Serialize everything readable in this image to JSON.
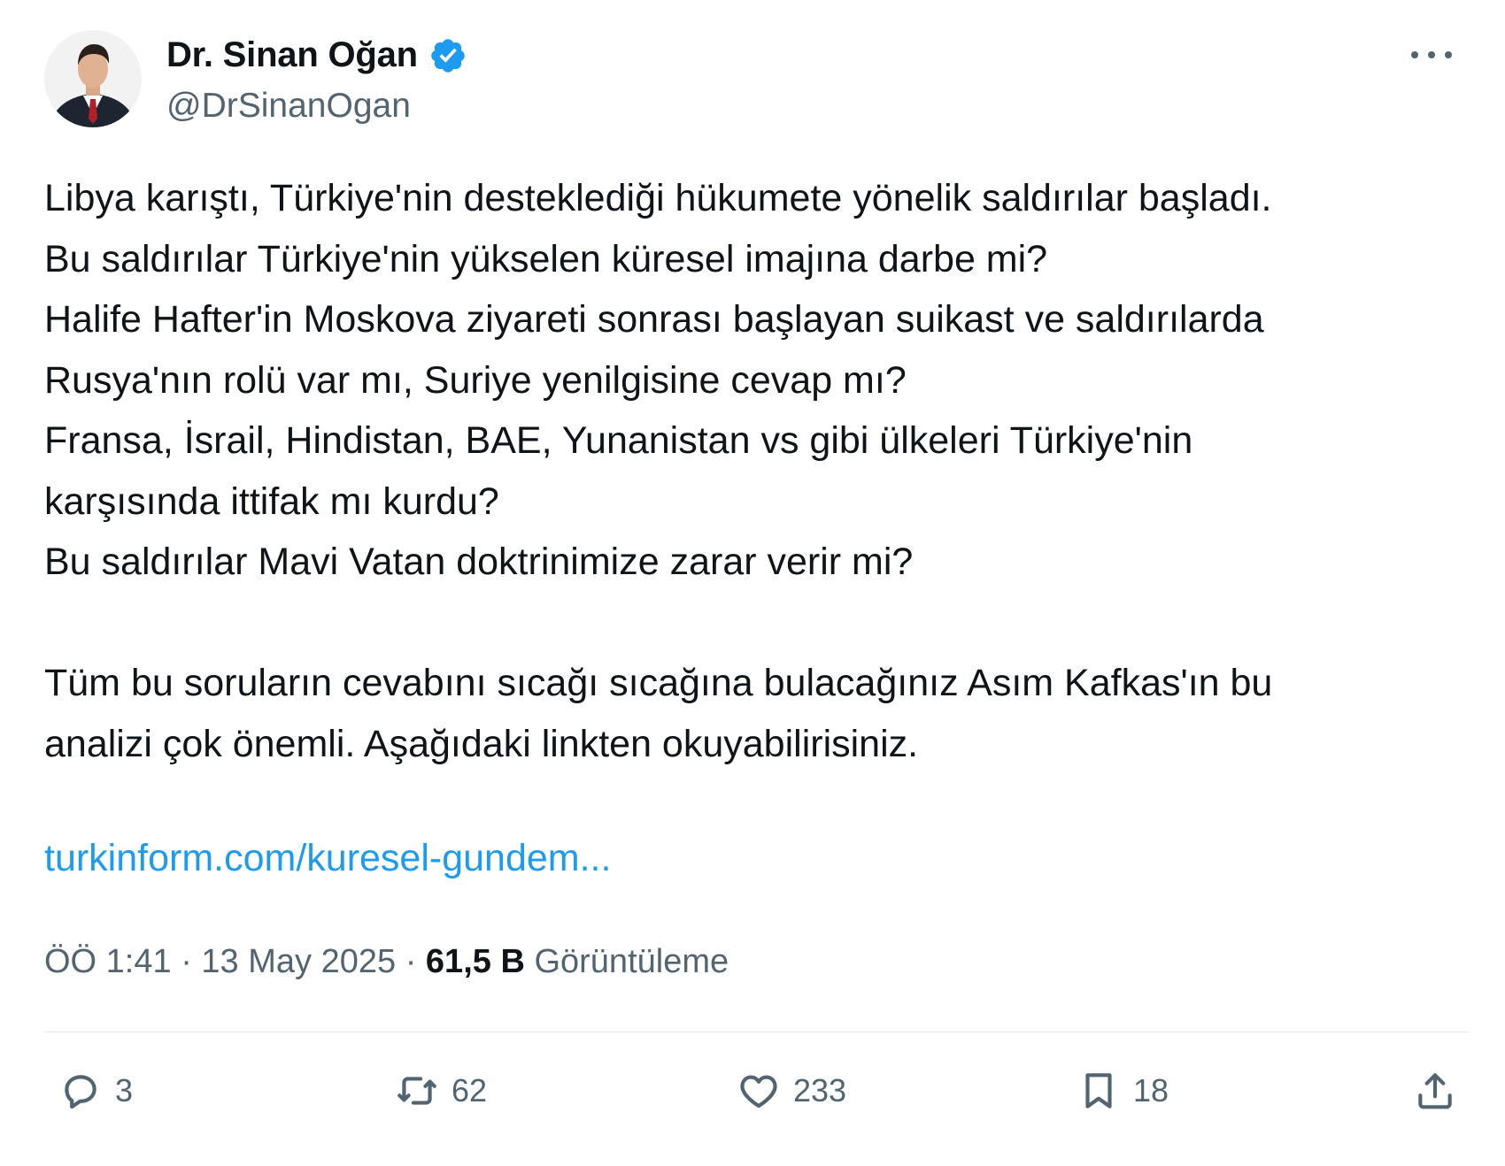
{
  "author": {
    "display_name": "Dr. Sinan Oğan",
    "handle": "@DrSinanOgan",
    "verified": true,
    "verified_color": "#1d9bf0"
  },
  "tweet": {
    "lines": [
      "Libya karıştı, Türkiye'nin desteklediği hükumete yönelik saldırılar başladı.",
      "Bu saldırılar Türkiye'nin yükselen küresel imajına darbe mi?",
      "Halife Hafter'in Moskova ziyareti sonrası başlayan suikast ve saldırılarda",
      "Rusya'nın rolü var mı, Suriye yenilgisine cevap mı?",
      "Fransa, İsrail, Hindistan, BAE, Yunanistan vs gibi ülkeleri Türkiye'nin",
      "karşısında ittifak mı kurdu?",
      "Bu saldırılar Mavi Vatan doktrinimize zarar verir mi?",
      "Tüm bu soruların cevabını sıcağı sıcağına bulacağınız Asım Kafkas'ın bu",
      "analizi çok önemli. Aşağıdaki linkten okuyabilirisiniz."
    ],
    "link": "turkinform.com/kuresel-gundem...",
    "link_color": "#1d9bf0"
  },
  "meta": {
    "time": "ÖÖ 1:41",
    "separator": " · ",
    "date": "13 May 2025",
    "views_count": "61,5 B",
    "views_label": "Görüntüleme"
  },
  "actions": {
    "reply_count": "3",
    "retweet_count": "62",
    "like_count": "233",
    "bookmark_count": "18"
  },
  "icons": {
    "verified": "verified-badge-icon",
    "more": "more-options-icon",
    "reply": "reply-icon",
    "retweet": "retweet-icon",
    "like": "heart-icon",
    "bookmark": "bookmark-icon",
    "share": "share-icon"
  }
}
